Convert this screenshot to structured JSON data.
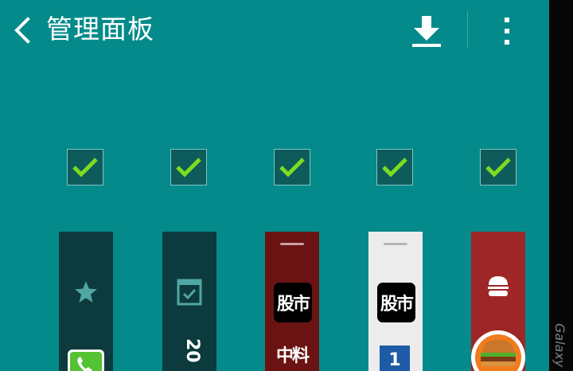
{
  "header": {
    "title": "管理面板",
    "back_icon": "chevron-left-icon",
    "download_icon": "download-icon",
    "more_icon": "more-vertical-icon"
  },
  "panels": [
    {
      "name": "favorites",
      "checked": true,
      "icon": "star-icon",
      "bottom_icon": "phone-icon",
      "bg": "#0c3a3d"
    },
    {
      "name": "calendar",
      "checked": true,
      "icon": "calendar-check-icon",
      "bottom_text": "20",
      "bg": "#0c3a3d"
    },
    {
      "name": "stocks-red",
      "checked": true,
      "badge": "股市",
      "bottom_text": "中料",
      "bg": "#6b1313"
    },
    {
      "name": "stocks-white",
      "checked": true,
      "badge": "股市",
      "bottom_text": "1",
      "bg": "#ececec"
    },
    {
      "name": "food",
      "checked": true,
      "icon": "burger-icon",
      "bottom_icon": "burger-logo-icon",
      "bg": "#9e2626"
    }
  ],
  "brand": {
    "text": "Galaxy"
  },
  "colors": {
    "background": "#048a8b",
    "check": "#7ddc1f",
    "checkbox_fill": "#0e5b5b"
  }
}
